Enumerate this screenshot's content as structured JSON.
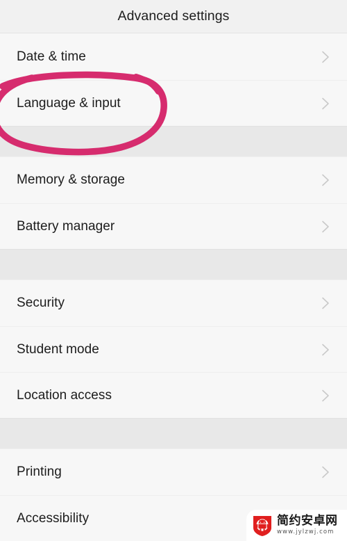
{
  "header": {
    "title": "Advanced settings"
  },
  "colors": {
    "page_background": "#f7f7f7",
    "header_background": "#f1f1f1",
    "section_band": "#e8e8e8",
    "row_text": "#1c1c1c",
    "chevron": "#c9c9c9",
    "annotation_pink": "#d62c6e",
    "watermark_red": "#e01f1f"
  },
  "sections": [
    {
      "rows": [
        {
          "label": "Date & time",
          "chevron": "chevron-right-icon"
        },
        {
          "label": "Language & input",
          "chevron": "chevron-right-icon",
          "annotated": true
        }
      ]
    },
    {
      "rows": [
        {
          "label": "Memory & storage",
          "chevron": "chevron-right-icon"
        },
        {
          "label": "Battery manager",
          "chevron": "chevron-right-icon"
        }
      ]
    },
    {
      "rows": [
        {
          "label": "Security",
          "chevron": "chevron-right-icon"
        },
        {
          "label": "Student mode",
          "chevron": "chevron-right-icon"
        },
        {
          "label": "Location access",
          "chevron": "chevron-right-icon"
        }
      ]
    },
    {
      "rows": [
        {
          "label": "Printing",
          "chevron": "chevron-right-icon"
        },
        {
          "label": "Accessibility",
          "chevron": "chevron-right-icon"
        }
      ]
    }
  ],
  "annotation": {
    "type": "hand-drawn-ellipse",
    "target": "Language & input",
    "color": "#d62c6e"
  },
  "watermark": {
    "site_name": "简约安卓网",
    "url": "www.jylzwj.com",
    "logo": "android-shield-icon"
  }
}
